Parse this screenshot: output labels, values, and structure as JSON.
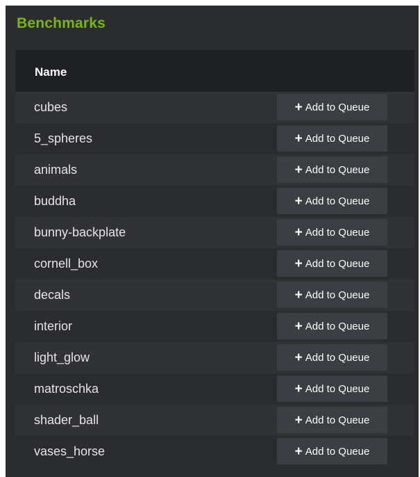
{
  "panel": {
    "title": "Benchmarks"
  },
  "table": {
    "columns": {
      "name": "Name"
    },
    "add_button": {
      "icon": "plus-icon",
      "icon_glyph": "+",
      "label": "Add to Queue"
    },
    "rows": [
      {
        "name": "cubes"
      },
      {
        "name": "5_spheres"
      },
      {
        "name": "animals"
      },
      {
        "name": "buddha"
      },
      {
        "name": "bunny-backplate"
      },
      {
        "name": "cornell_box"
      },
      {
        "name": "decals"
      },
      {
        "name": "interior"
      },
      {
        "name": "light_glow"
      },
      {
        "name": "matroschka"
      },
      {
        "name": "shader_ball"
      },
      {
        "name": "vases_horse"
      }
    ]
  },
  "colors": {
    "accent": "#76b900",
    "panel_bg": "#2a2c30",
    "header_bg": "#1e2023",
    "button_bg": "#3b3e43"
  }
}
